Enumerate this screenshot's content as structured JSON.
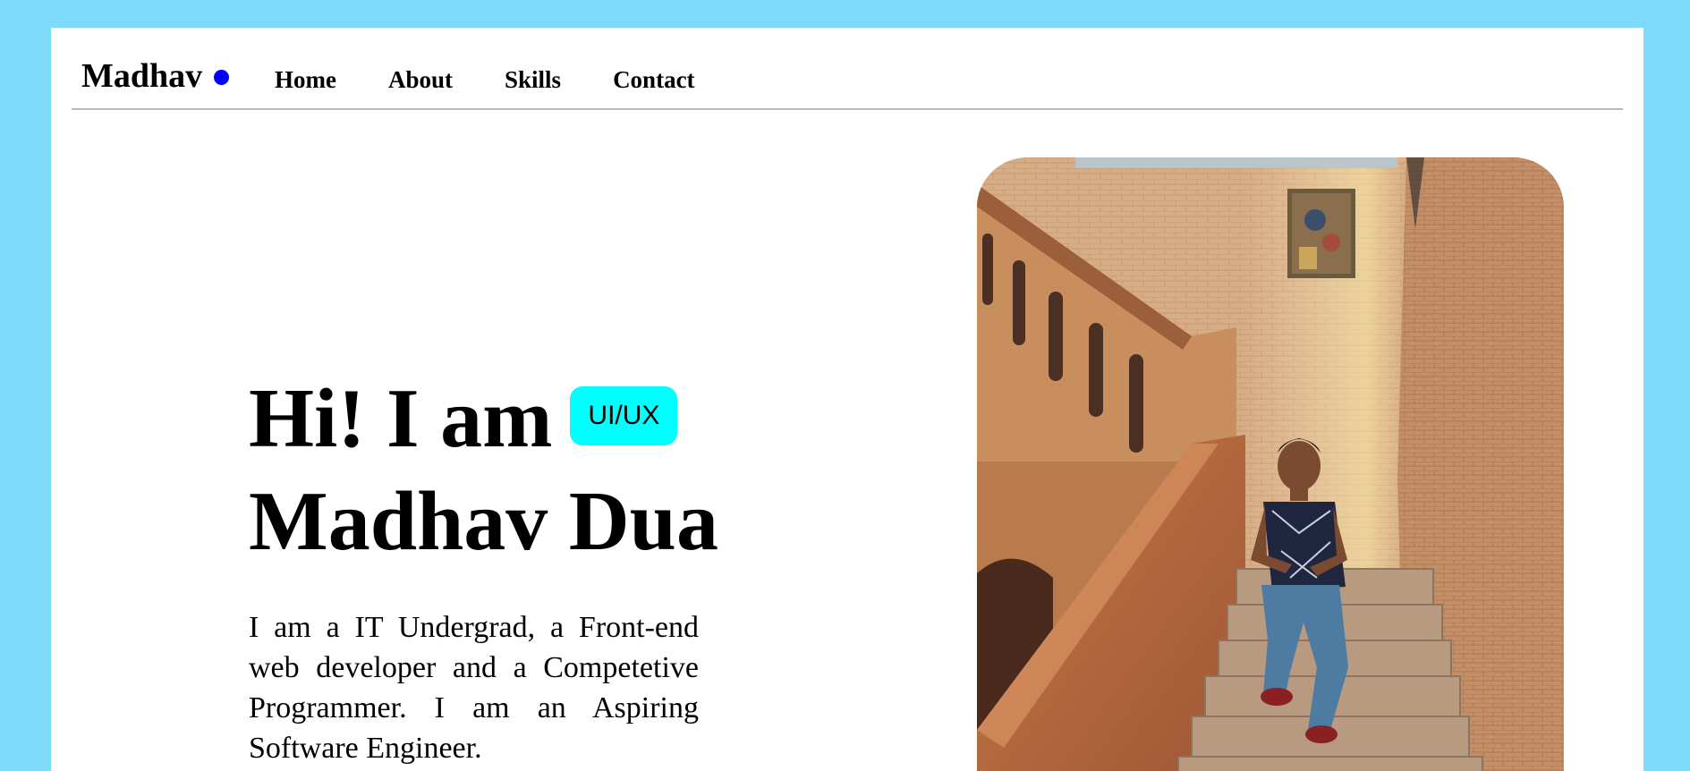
{
  "nav": {
    "brand": "Madhav",
    "links": [
      "Home",
      "About",
      "Skills",
      "Contact"
    ]
  },
  "hero": {
    "greeting": "Hi! I am",
    "badge": "UI/UX",
    "name": "Madhav Dua",
    "description": "I am a IT Undergrad, a Front-end web developer and a Competetive Programmer. I am an Aspiring Software Engineer."
  },
  "colors": {
    "background": "#7ddaf8",
    "brand_dot": "#0000ff",
    "badge_bg": "#00ffff"
  },
  "photo": {
    "subject": "person-sitting-on-brick-staircase"
  }
}
